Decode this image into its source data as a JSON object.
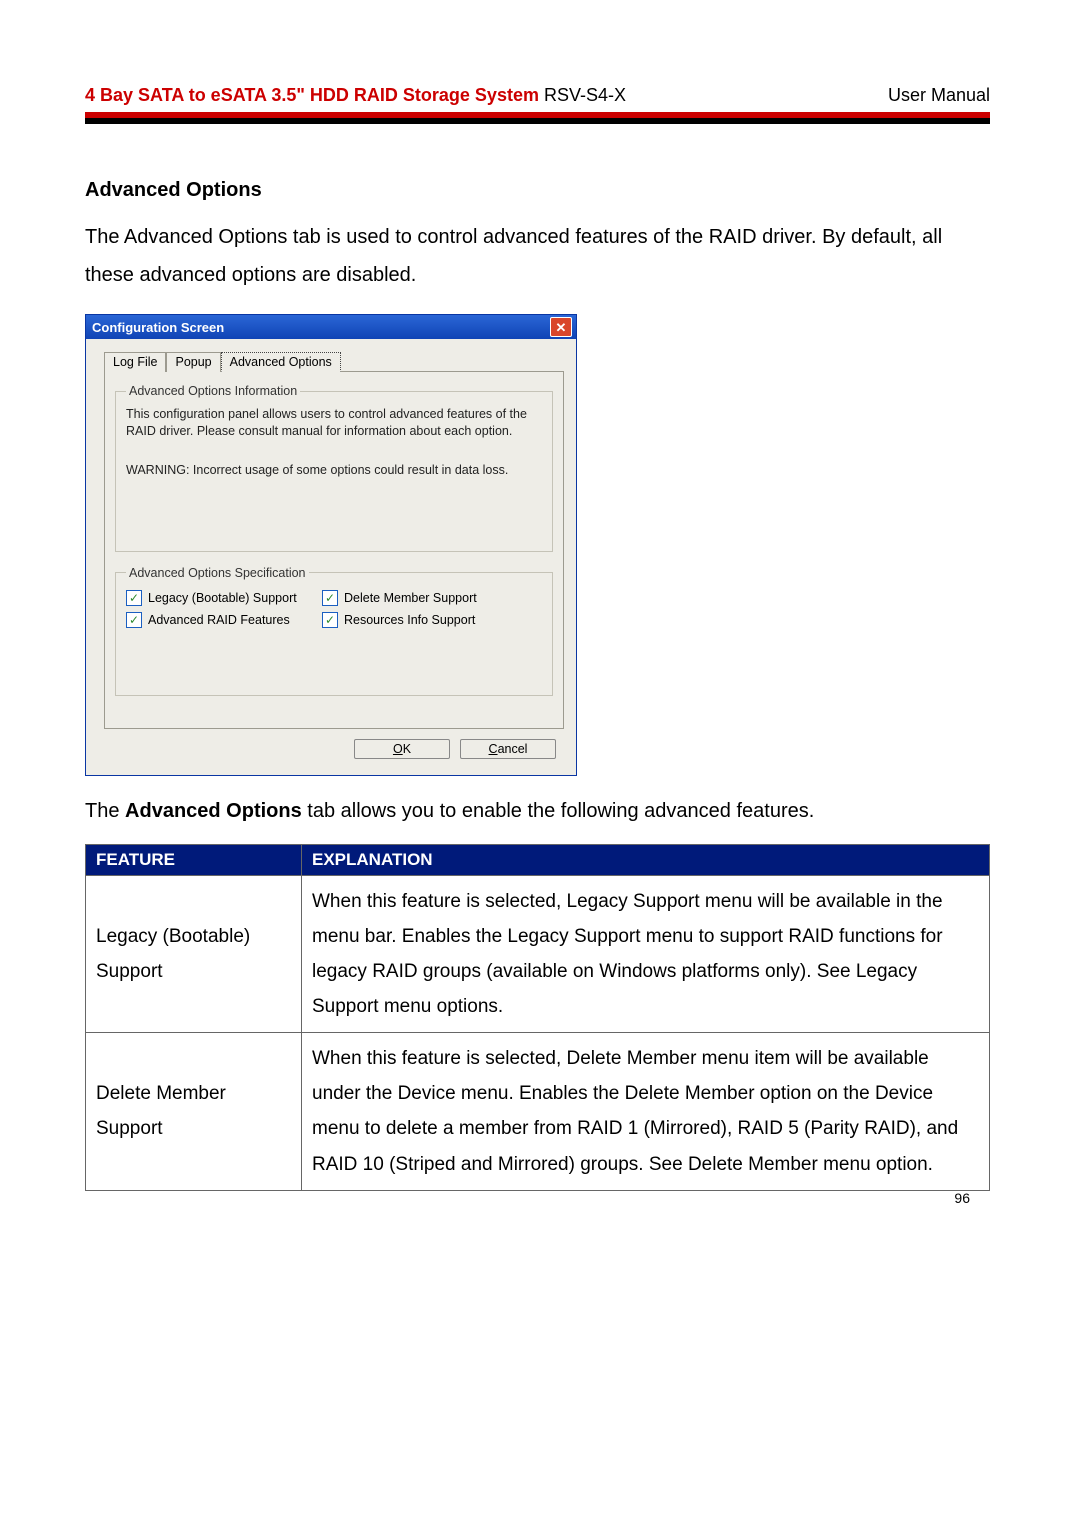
{
  "header": {
    "title_bold": "4 Bay SATA to eSATA 3.5\" HDD RAID Storage System ",
    "title_model": "RSV-S4-X",
    "right": "User Manual"
  },
  "section_title": "Advanced Options",
  "intro_para": "The Advanced Options tab is used to control advanced features of the RAID driver. By default, all these advanced options are disabled.",
  "dialog": {
    "title": "Configuration Screen",
    "tabs": {
      "log": "Log File",
      "popup": "Popup",
      "adv": "Advanced Options"
    },
    "info_legend": "Advanced Options Information",
    "info_text": "This configuration panel allows users to control advanced features of the RAID driver. Please consult manual for information about each option.",
    "info_warn": "WARNING: Incorrect usage of some options could result in data loss.",
    "spec_legend": "Advanced Options Specification",
    "opts": {
      "legacy": "Legacy (Bootable) Support",
      "delete": "Delete Member Support",
      "advraid": "Advanced RAID Features",
      "resinfo": "Resources Info Support"
    },
    "ok": "OK",
    "cancel": "Cancel"
  },
  "after_para_prefix": "The ",
  "after_para_bold": "Advanced Options",
  "after_para_suffix": " tab allows you to enable the following advanced features.",
  "table": {
    "h1": "Feature",
    "h2": "Explanation",
    "r1f": "Legacy (Bootable) Support",
    "r1e": "When this feature is selected, Legacy Support menu will be available in the menu bar. Enables the Legacy Support menu to support RAID functions for legacy RAID groups (available on Windows platforms only). See Legacy Support menu options.",
    "r2f": "Delete Member Support",
    "r2e": "When this feature is selected, Delete Member menu item will be available under the Device menu. Enables the Delete Member option on the Device menu to delete a member from RAID 1 (Mirrored), RAID 5 (Parity RAID), and RAID 10 (Striped and Mirrored) groups. See Delete Member menu option."
  },
  "page_number": "96"
}
